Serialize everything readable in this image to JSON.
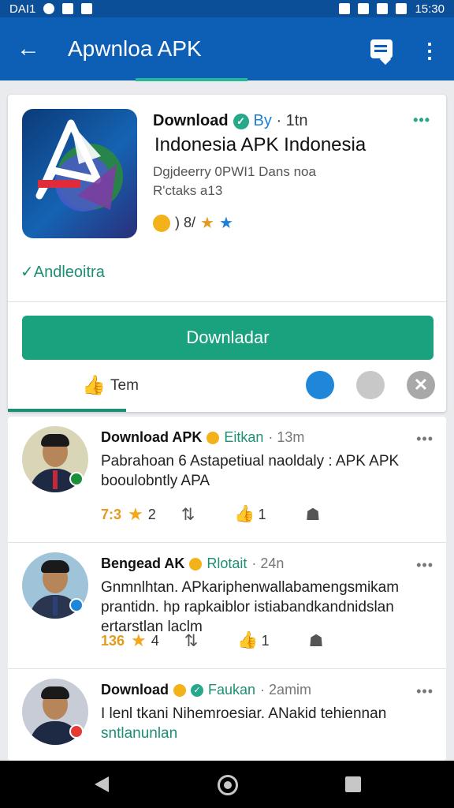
{
  "status_bar": {
    "left_text": "DAI1",
    "time": "15:30"
  },
  "app_bar": {
    "back_icon": "arrow-left-icon",
    "title": "Apwnloa APK",
    "chat_icon": "chat-icon",
    "more_icon": "more-vert-icon"
  },
  "app_card": {
    "header_label": "Download",
    "by_label": "By",
    "by_time": "· 1tn",
    "app_name": "Indonesia APK Indonesia",
    "meta_line1": "Dgjdeerry  0PWI1 Dans noa",
    "meta_line2": "R'ctaks a13",
    "rating_text": ") 8/",
    "verified_text": "✓Andleoitra",
    "download_label": "Downladar",
    "action_label": "Tem"
  },
  "posts": [
    {
      "author": "Download APK",
      "tag": "Eitkan",
      "time": "· 13m",
      "body": "Pabrahoan 6 Astapetiual naoldaly : APK APK booulobntly APA",
      "likes": "7:3",
      "stars": "2",
      "comments": "1",
      "badge_color": "#1c8f3a"
    },
    {
      "author": "Bengead AK",
      "tag": "Rlotait",
      "time": "· 24n",
      "body": "Gnmnlhtan. APkariphenwallabamengsmikam prantidn. hp rapkaiblor istiabandkandnidslan ertarstlan laclm",
      "likes": "136",
      "stars": "4",
      "comments": "1",
      "badge_color": "#1e86d8"
    },
    {
      "author": "Download",
      "tag": "Faukan",
      "time": "· 2amim",
      "body": "I lenl tkani Nihemroesiar. ANakid tehiennan",
      "body_tag": "sntlanunlan",
      "likes": "",
      "stars": "",
      "comments": "",
      "badge_color": "#e53935"
    }
  ],
  "colors": {
    "primary": "#0d5eb5",
    "accent": "#1aa27f",
    "link": "#1e7fd6"
  },
  "nav": {
    "back_icon": "nav-back-icon",
    "home_icon": "nav-home-icon",
    "recent_icon": "nav-recent-icon"
  }
}
